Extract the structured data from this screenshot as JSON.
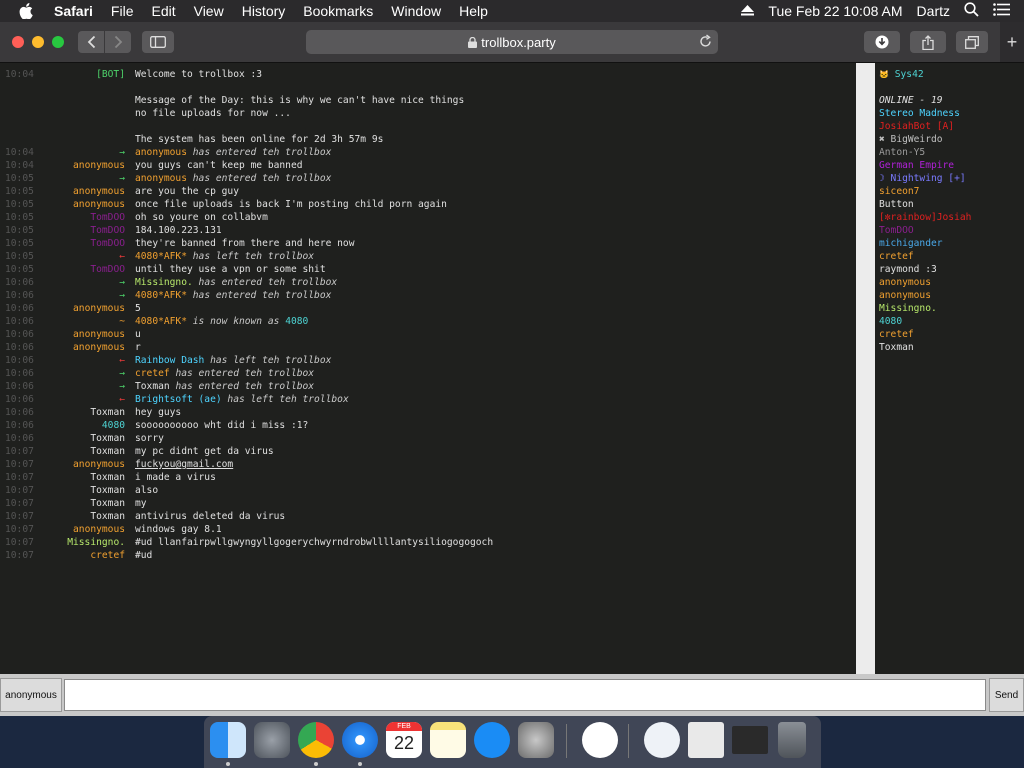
{
  "menubar": {
    "app": "Safari",
    "items": [
      "File",
      "Edit",
      "View",
      "History",
      "Bookmarks",
      "Window",
      "Help"
    ],
    "datetime": "Tue Feb 22  10:08 AM",
    "user": "Dartz"
  },
  "toolbar": {
    "url": "trollbox.party",
    "new_tab": "+"
  },
  "chat": {
    "rows": [
      {
        "time": "10:04",
        "nick": "[BOT]",
        "nick_color": "#4ed46b",
        "msg": "Welcome to trollbox :3"
      },
      {
        "time": "",
        "nick": "",
        "nick_color": "#e0e0e0",
        "msg": "Message of the Day: this is why we can't have nice things"
      },
      {
        "time": "",
        "nick": "",
        "nick_color": "#e0e0e0",
        "msg": "no file uploads for now ..."
      },
      {
        "time": "",
        "nick": "",
        "nick_color": "#e0e0e0",
        "msg": "The system has been online for 2d 3h 57m 9s"
      },
      {
        "time": "10:04",
        "nick": "→",
        "nick_color": "#4ed46b",
        "actor": "anonymous",
        "actor_color": "#f0a030",
        "msg": "has entered teh trollbox"
      },
      {
        "time": "10:04",
        "nick": "anonymous",
        "nick_color": "#f0a030",
        "msg": "you guys can't keep me banned"
      },
      {
        "time": "10:05",
        "nick": "→",
        "nick_color": "#4ed46b",
        "actor": "anonymous",
        "actor_color": "#f0a030",
        "msg": "has entered teh trollbox"
      },
      {
        "time": "10:05",
        "nick": "anonymous",
        "nick_color": "#f0a030",
        "msg": "are you the cp guy"
      },
      {
        "time": "10:05",
        "nick": "anonymous",
        "nick_color": "#f0a030",
        "msg": "once file uploads is back I'm posting child porn again"
      },
      {
        "time": "10:05",
        "nick": "TomDOO",
        "nick_color": "#8a1f8e",
        "msg": "oh so youre on collabvm"
      },
      {
        "time": "10:05",
        "nick": "TomDOO",
        "nick_color": "#8a1f8e",
        "msg": "184.100.223.131"
      },
      {
        "time": "10:05",
        "nick": "TomDOO",
        "nick_color": "#8a1f8e",
        "msg": "they're banned from there and here now"
      },
      {
        "time": "10:05",
        "nick": "←",
        "nick_color": "#e83a3a",
        "actor": "4080*AFK*",
        "actor_color": "#f0a030",
        "msg": "has left teh trollbox"
      },
      {
        "time": "10:05",
        "nick": "TomDOO",
        "nick_color": "#8a1f8e",
        "msg": "until they use a vpn or some shit"
      },
      {
        "time": "10:06",
        "nick": "→",
        "nick_color": "#4ed46b",
        "actor": "Missingno.",
        "actor_color": "#b7e86b",
        "msg": "has entered teh trollbox"
      },
      {
        "time": "10:06",
        "nick": "→",
        "nick_color": "#4ed46b",
        "actor": "4080*AFK*",
        "actor_color": "#f0a030",
        "msg": "has entered teh trollbox"
      },
      {
        "time": "10:06",
        "nick": "anonymous",
        "nick_color": "#f0a030",
        "msg": "5"
      },
      {
        "time": "10:06",
        "nick": "~",
        "nick_color": "#f0a030",
        "actor": "4080*AFK*",
        "actor_color": "#f0a030",
        "msg": "is now known as",
        "extra": "4080",
        "extra_color": "#4ed4d4"
      },
      {
        "time": "10:06",
        "nick": "anonymous",
        "nick_color": "#f0a030",
        "msg": "u"
      },
      {
        "time": "10:06",
        "nick": "anonymous",
        "nick_color": "#f0a030",
        "msg": "r"
      },
      {
        "time": "10:06",
        "nick": "←",
        "nick_color": "#e83a3a",
        "actor": "Rainbow Dash",
        "actor_color": "#4ed4ff",
        "msg": "has left teh trollbox"
      },
      {
        "time": "10:06",
        "nick": "→",
        "nick_color": "#4ed46b",
        "actor": "cretef",
        "actor_color": "#f0a030",
        "msg": "has entered teh trollbox"
      },
      {
        "time": "10:06",
        "nick": "→",
        "nick_color": "#4ed46b",
        "actor": "Toxman",
        "actor_color": "#e0e0e0",
        "msg": "has entered teh trollbox"
      },
      {
        "time": "10:06",
        "nick": "←",
        "nick_color": "#e83a3a",
        "actor": "Brightsoft (ae)",
        "actor_color": "#4ed4ff",
        "msg": "has left teh trollbox"
      },
      {
        "time": "10:06",
        "nick": "Toxman",
        "nick_color": "#e0e0e0",
        "msg": "hey guys"
      },
      {
        "time": "10:06",
        "nick": "4080",
        "nick_color": "#4ed4d4",
        "msg": "soooooooooo wht did i miss :1?"
      },
      {
        "time": "10:06",
        "nick": "Toxman",
        "nick_color": "#e0e0e0",
        "msg": "sorry"
      },
      {
        "time": "10:07",
        "nick": "Toxman",
        "nick_color": "#e0e0e0",
        "msg": "my pc didnt get da virus"
      },
      {
        "time": "10:07",
        "nick": "anonymous",
        "nick_color": "#f0a030",
        "msg": "fuckyou@gmail.com",
        "underline": true
      },
      {
        "time": "10:07",
        "nick": "Toxman",
        "nick_color": "#e0e0e0",
        "msg": "i made  a virus"
      },
      {
        "time": "10:07",
        "nick": "Toxman",
        "nick_color": "#e0e0e0",
        "msg": "also"
      },
      {
        "time": "10:07",
        "nick": "Toxman",
        "nick_color": "#e0e0e0",
        "msg": "my"
      },
      {
        "time": "10:07",
        "nick": "Toxman",
        "nick_color": "#e0e0e0",
        "msg": "antivirus deleted da virus"
      },
      {
        "time": "10:07",
        "nick": "anonymous",
        "nick_color": "#f0a030",
        "msg": "windows gay 8.1"
      },
      {
        "time": "10:07",
        "nick": "Missingno.",
        "nick_color": "#b7e86b",
        "msg": "#ud llanfairpwllgwyngyllgogerychwyrndrobwllllantysiliogogogoch"
      },
      {
        "time": "10:07",
        "nick": "cretef",
        "nick_color": "#f0a030",
        "msg": "#ud"
      }
    ]
  },
  "userlist": {
    "me": {
      "icon": "🐱",
      "name": "Sys42",
      "color": "#4ed4d4"
    },
    "online_label": "ONLINE - 19",
    "users": [
      {
        "name": "Stereo Madness",
        "color": "#4ed4ff"
      },
      {
        "name": "JosiahBot [A]",
        "color": "#e02020"
      },
      {
        "name": "✖ BigWeirdo",
        "color": "#c0c0c0"
      },
      {
        "name": "Anton-Y5",
        "color": "#9a9a9a"
      },
      {
        "name": "German Empire",
        "color": "#b020d8"
      },
      {
        "name": "☽ Nightwing [+]",
        "color": "#7a7aff"
      },
      {
        "name": "siceon7",
        "color": "#f0a030"
      },
      {
        "name": "Button",
        "color": "#e0e0e0"
      },
      {
        "name": "[✼rainbow]Josiah",
        "color": "#e02020"
      },
      {
        "name": "TomDOO",
        "color": "#8a1f8e"
      },
      {
        "name": "michigander",
        "color": "#4aa8e8"
      },
      {
        "name": "cretef",
        "color": "#f0a030"
      },
      {
        "name": "raymond :3",
        "color": "#e0e0e0"
      },
      {
        "name": "anonymous",
        "color": "#f0a030"
      },
      {
        "name": "anonymous",
        "color": "#f0a030"
      },
      {
        "name": "Missingno.",
        "color": "#b7e86b"
      },
      {
        "name": "4080",
        "color": "#4ed4d4"
      },
      {
        "name": "cretef",
        "color": "#f0a030"
      },
      {
        "name": "Toxman",
        "color": "#e0e0e0"
      }
    ]
  },
  "input": {
    "nick_label": "anonymous",
    "value": "",
    "send_label": "Send"
  },
  "dock": {
    "calendar_month": "FEB",
    "calendar_day": "22"
  }
}
